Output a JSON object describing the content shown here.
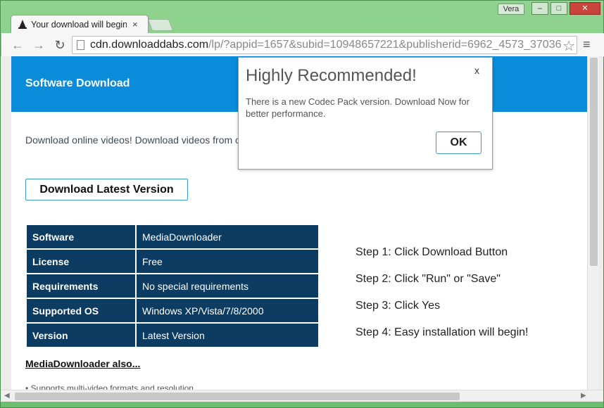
{
  "browser": {
    "tab_title": "Your download will begin",
    "tab_close": "×",
    "profile_name": "Vera",
    "window_buttons": {
      "minimize": "–",
      "maximize": "□",
      "close": "✕"
    },
    "url_host": "cdn.downloaddabs.com",
    "url_rest": "/lp/?appid=1657&subid=10948657221&publisherid=6962_4573_37036",
    "icons": {
      "back": "←",
      "forward": "→",
      "reload": "↻",
      "star": "☆",
      "menu": "≡"
    }
  },
  "page": {
    "banner_title": "Software Download",
    "intro": "Download online videos! Download videos from o",
    "download_button": "Download Latest Version",
    "info_table": [
      {
        "label": "Software",
        "value": "MediaDownloader"
      },
      {
        "label": "License",
        "value": "Free"
      },
      {
        "label": "Requirements",
        "value": "No special requirements"
      },
      {
        "label": "Supported OS",
        "value": "Windows XP/Vista/7/8/2000"
      },
      {
        "label": "Version",
        "value": "Latest Version"
      }
    ],
    "steps": [
      "Step 1: Click Download Button",
      "Step 2: Click \"Run\" or \"Save\"",
      "Step 3: Click Yes",
      "Step 4: Easy installation will begin!"
    ],
    "also_link": "MediaDownloader also...",
    "bullet_partial": "• Supports multi-video formats and resolution"
  },
  "modal": {
    "title": "Highly Recommended!",
    "close": "x",
    "body": "There is a new Codec Pack version. Download Now for better performance.",
    "ok_label": "OK"
  },
  "colors": {
    "banner": "#0a8cdb",
    "table_cell": "#0d3c62",
    "window_frame": "#76c27a",
    "button_border": "#3d97cf"
  }
}
